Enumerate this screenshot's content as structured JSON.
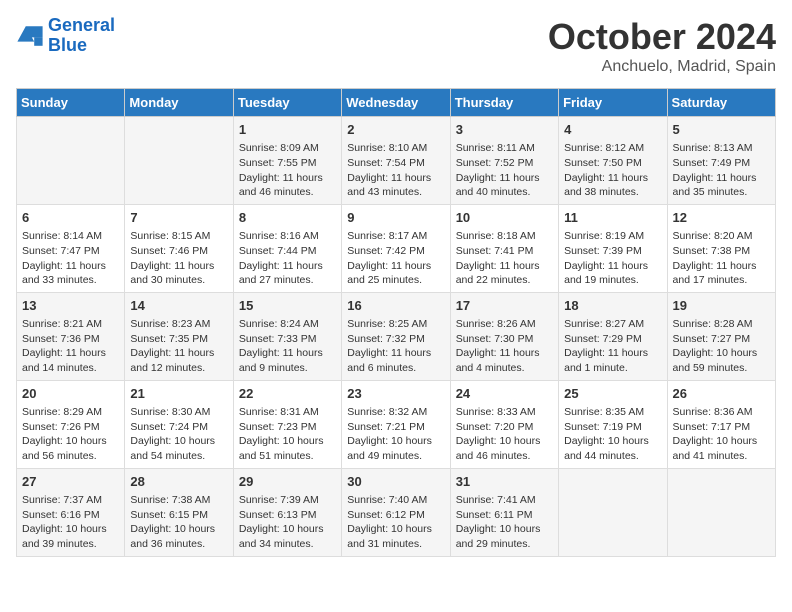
{
  "header": {
    "logo_line1": "General",
    "logo_line2": "Blue",
    "month": "October 2024",
    "location": "Anchuelo, Madrid, Spain"
  },
  "days_of_week": [
    "Sunday",
    "Monday",
    "Tuesday",
    "Wednesday",
    "Thursday",
    "Friday",
    "Saturday"
  ],
  "weeks": [
    [
      {
        "day": "",
        "content": ""
      },
      {
        "day": "",
        "content": ""
      },
      {
        "day": "1",
        "content": "Sunrise: 8:09 AM\nSunset: 7:55 PM\nDaylight: 11 hours and 46 minutes."
      },
      {
        "day": "2",
        "content": "Sunrise: 8:10 AM\nSunset: 7:54 PM\nDaylight: 11 hours and 43 minutes."
      },
      {
        "day": "3",
        "content": "Sunrise: 8:11 AM\nSunset: 7:52 PM\nDaylight: 11 hours and 40 minutes."
      },
      {
        "day": "4",
        "content": "Sunrise: 8:12 AM\nSunset: 7:50 PM\nDaylight: 11 hours and 38 minutes."
      },
      {
        "day": "5",
        "content": "Sunrise: 8:13 AM\nSunset: 7:49 PM\nDaylight: 11 hours and 35 minutes."
      }
    ],
    [
      {
        "day": "6",
        "content": "Sunrise: 8:14 AM\nSunset: 7:47 PM\nDaylight: 11 hours and 33 minutes."
      },
      {
        "day": "7",
        "content": "Sunrise: 8:15 AM\nSunset: 7:46 PM\nDaylight: 11 hours and 30 minutes."
      },
      {
        "day": "8",
        "content": "Sunrise: 8:16 AM\nSunset: 7:44 PM\nDaylight: 11 hours and 27 minutes."
      },
      {
        "day": "9",
        "content": "Sunrise: 8:17 AM\nSunset: 7:42 PM\nDaylight: 11 hours and 25 minutes."
      },
      {
        "day": "10",
        "content": "Sunrise: 8:18 AM\nSunset: 7:41 PM\nDaylight: 11 hours and 22 minutes."
      },
      {
        "day": "11",
        "content": "Sunrise: 8:19 AM\nSunset: 7:39 PM\nDaylight: 11 hours and 19 minutes."
      },
      {
        "day": "12",
        "content": "Sunrise: 8:20 AM\nSunset: 7:38 PM\nDaylight: 11 hours and 17 minutes."
      }
    ],
    [
      {
        "day": "13",
        "content": "Sunrise: 8:21 AM\nSunset: 7:36 PM\nDaylight: 11 hours and 14 minutes."
      },
      {
        "day": "14",
        "content": "Sunrise: 8:23 AM\nSunset: 7:35 PM\nDaylight: 11 hours and 12 minutes."
      },
      {
        "day": "15",
        "content": "Sunrise: 8:24 AM\nSunset: 7:33 PM\nDaylight: 11 hours and 9 minutes."
      },
      {
        "day": "16",
        "content": "Sunrise: 8:25 AM\nSunset: 7:32 PM\nDaylight: 11 hours and 6 minutes."
      },
      {
        "day": "17",
        "content": "Sunrise: 8:26 AM\nSunset: 7:30 PM\nDaylight: 11 hours and 4 minutes."
      },
      {
        "day": "18",
        "content": "Sunrise: 8:27 AM\nSunset: 7:29 PM\nDaylight: 11 hours and 1 minute."
      },
      {
        "day": "19",
        "content": "Sunrise: 8:28 AM\nSunset: 7:27 PM\nDaylight: 10 hours and 59 minutes."
      }
    ],
    [
      {
        "day": "20",
        "content": "Sunrise: 8:29 AM\nSunset: 7:26 PM\nDaylight: 10 hours and 56 minutes."
      },
      {
        "day": "21",
        "content": "Sunrise: 8:30 AM\nSunset: 7:24 PM\nDaylight: 10 hours and 54 minutes."
      },
      {
        "day": "22",
        "content": "Sunrise: 8:31 AM\nSunset: 7:23 PM\nDaylight: 10 hours and 51 minutes."
      },
      {
        "day": "23",
        "content": "Sunrise: 8:32 AM\nSunset: 7:21 PM\nDaylight: 10 hours and 49 minutes."
      },
      {
        "day": "24",
        "content": "Sunrise: 8:33 AM\nSunset: 7:20 PM\nDaylight: 10 hours and 46 minutes."
      },
      {
        "day": "25",
        "content": "Sunrise: 8:35 AM\nSunset: 7:19 PM\nDaylight: 10 hours and 44 minutes."
      },
      {
        "day": "26",
        "content": "Sunrise: 8:36 AM\nSunset: 7:17 PM\nDaylight: 10 hours and 41 minutes."
      }
    ],
    [
      {
        "day": "27",
        "content": "Sunrise: 7:37 AM\nSunset: 6:16 PM\nDaylight: 10 hours and 39 minutes."
      },
      {
        "day": "28",
        "content": "Sunrise: 7:38 AM\nSunset: 6:15 PM\nDaylight: 10 hours and 36 minutes."
      },
      {
        "day": "29",
        "content": "Sunrise: 7:39 AM\nSunset: 6:13 PM\nDaylight: 10 hours and 34 minutes."
      },
      {
        "day": "30",
        "content": "Sunrise: 7:40 AM\nSunset: 6:12 PM\nDaylight: 10 hours and 31 minutes."
      },
      {
        "day": "31",
        "content": "Sunrise: 7:41 AM\nSunset: 6:11 PM\nDaylight: 10 hours and 29 minutes."
      },
      {
        "day": "",
        "content": ""
      },
      {
        "day": "",
        "content": ""
      }
    ]
  ]
}
